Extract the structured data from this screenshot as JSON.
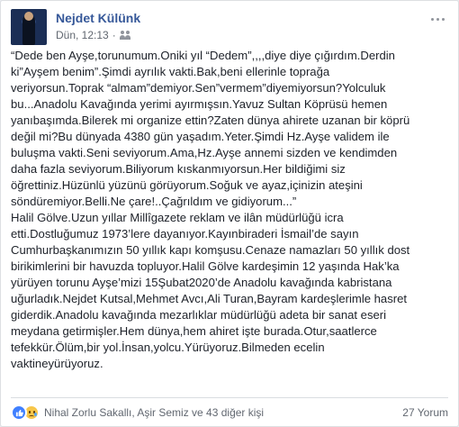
{
  "post": {
    "author": "Nejdet Külünk",
    "timestamp": "Dün, 12:13",
    "separator": "·",
    "audience_icon": "friends-icon",
    "lines": [
      "“Dede ben Ayşe,torunumum.Oniki yıl “Dedem”,,,,diye diye çığırdım.Derdin",
      "ki”Ayşem benim”.Şimdi ayrılık vakti.Bak,beni ellerinle toprağa",
      "veriyorsun.Toprak “almam”demiyor.Sen”vermem”diyemiyorsun?Yolculuk",
      "bu...Anadolu Kavağında yerimi ayırmışsın.Yavuz Sultan Köprüsü hemen",
      "yanıbaşımda.Bilerek mi organize ettin?Zaten dünya ahirete uzanan bir köprü",
      "değil mi?Bu dünyada 4380 gün yaşadım.Yeter.Şimdi Hz.Ayşe validem ile",
      "buluşma vakti.Seni seviyorum.Ama,Hz.Ayşe annemi sizden ve kendimden",
      "daha fazla seviyorum.Biliyorum kıskanmıyorsun.Her bildiğimi siz",
      "öğrettiniz.Hüzünlü yüzünü görüyorum.Soğuk ve ayaz,içinizin ateşini",
      "söndüremiyor.Belli.Ne çare!..Çağrıldım ve gidiyorum...”",
      "Halil Gölve.Uzun yıllar Millîgazete reklam ve ilân müdürlüğü icra",
      "etti.Dostluğumuz 1973’lere dayanıyor.Kayınbiraderi İsmail’de sayın",
      "Cumhurbaşkanımızın 50 yıllık kapı komşusu.Cenaze namazları 50 yıllık dost",
      "birikimlerini bir havuzda topluyor.Halil Gölve kardeşimin 12 yaşında Hak’ka",
      "yürüyen torunu Ayşe’mizi 15Şubat2020’de Anadolu kavağında kabristana",
      "uğurladık.Nejdet Kutsal,Mehmet Avcı,Ali Turan,Bayram kardeşlerimle hasret",
      "giderdik.Anadolu kavağında mezarlıklar müdürlüğü adeta bir sanat eseri",
      "meydana getirmişler.Hem dünya,hem ahiret işte burada.Otur,saatlerce",
      "tefekkür.Ölüm,bir yol.İnsan,yolcu.Yürüyoruz.Bilmeden ecelin",
      "vaktineyürüyoruz."
    ]
  },
  "footer": {
    "reactors": "Nihal Zorlu Sakallı, Aşir Semiz ve 43 diğer kişi",
    "comments": "27 Yorum"
  },
  "colors": {
    "author": "#365899",
    "text": "#1d2129",
    "meta": "#616770",
    "like": "#4080ff",
    "sad": "#f7c64a"
  }
}
